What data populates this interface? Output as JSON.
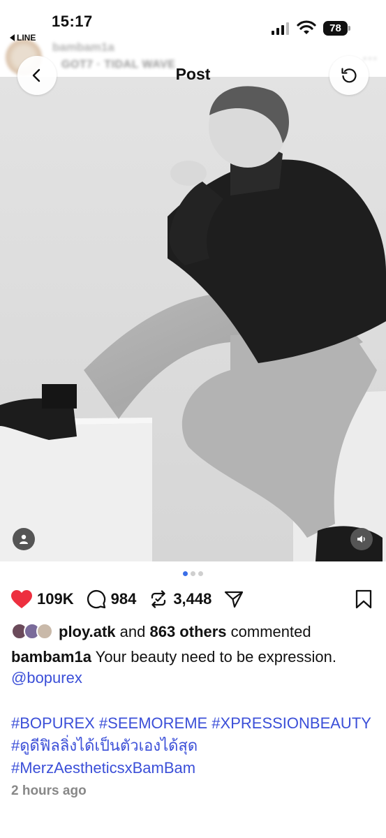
{
  "status_bar": {
    "time": "15:17",
    "back_app": "LINE",
    "battery": "78",
    "icons": [
      "signal-icon",
      "wifi-icon",
      "battery-icon"
    ]
  },
  "underlying_header": {
    "username": "bambam1a",
    "song": "GOT7 · TIDAL WAVE"
  },
  "nav": {
    "title": "Post",
    "back_icon": "chevron-left-icon",
    "refresh_icon": "refresh-icon"
  },
  "carousel": {
    "count": 3,
    "active_index": 0
  },
  "actions": {
    "likes": "109K",
    "comments": "984",
    "reposts": "3,448",
    "like_color": "#ed2f3f"
  },
  "comment_summary": {
    "user": "ploy.atk",
    "and": "and",
    "others": "863 others",
    "verb": "commented"
  },
  "caption": {
    "user": "bambam1a",
    "text": "Your beauty need to be expression.",
    "mention": "@bopurex"
  },
  "hashtags": "#BOPUREX #SEEMOREME #XPRESSIONBEAUTY #ดูดีฟิลลิ่งได้เป็นตัวเองได้สุด #MerzAestheticsxBamBam",
  "posted": "2 hours ago",
  "colors": {
    "link": "#3b4fd8",
    "active_dot": "#3a6ee8"
  }
}
